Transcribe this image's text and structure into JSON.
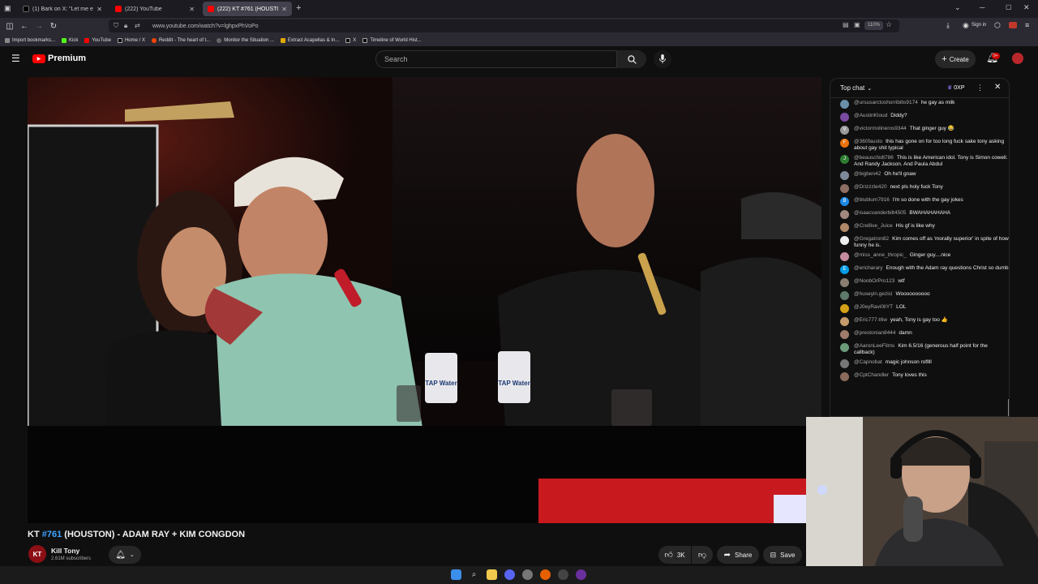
{
  "browser": {
    "tabs": [
      {
        "title": "(1) Bark on X: \"Let me explain w",
        "active": false
      },
      {
        "title": "(222) YouTube",
        "active": false
      },
      {
        "title": "(222) KT #761 (HOUSTON)",
        "active": true
      }
    ],
    "new_tab": "+",
    "url": "www.youtube.com/watch?v=lghpxPhVoPo",
    "zoom": "110%",
    "sign_in": "Sign in",
    "bookmarks": [
      "Import bookmarks...",
      "Kick",
      "YouTube",
      "Home / X",
      "Reddit - The heart of t...",
      "Monitor the Situation ...",
      "Extract Acapellas & In...",
      "X",
      "Timeline of World Hist..."
    ]
  },
  "youtube": {
    "logo_text": "Premium",
    "search_placeholder": "Search",
    "create_label": "Create",
    "notif_badge": "9+"
  },
  "chat": {
    "header": "Top chat",
    "points": "0XP",
    "messages": [
      {
        "author": "@ursusarctoshorribilis9174",
        "text": "he gay as milk",
        "color": "#6a8fa8"
      },
      {
        "author": "@AustinKloud",
        "text": "Diddy?",
        "color": "#7a4aa0"
      },
      {
        "author": "@victormolineros9344",
        "text": "That ginger guy 😂",
        "color": "#9a9a9a",
        "initial": "V"
      },
      {
        "author": "@360fausto",
        "text": "this has gone on for too long fuck sake tony asking about gay shit typical",
        "color": "#e8710a",
        "initial": "F"
      },
      {
        "author": "@beauschidt786",
        "text": "This is like American idol. Tony is Simon cowell. And Randy Jackson. And Paula Abdul",
        "color": "#2e7d32",
        "initial": "J"
      },
      {
        "author": "@bigben42",
        "text": "Oh he'll gnaw",
        "color": "#7c8a99"
      },
      {
        "author": "@Drizzzle420",
        "text": "next pls holy fuck Tony",
        "color": "#8d6e63"
      },
      {
        "author": "@blublum7916",
        "text": "I'm so done with the gay jokes",
        "color": "#1e88e5",
        "initial": "B"
      },
      {
        "author": "@isaacvanderbilt4505",
        "text": "BWAHAHAHAHA",
        "color": "#a1887f"
      },
      {
        "author": "@Cre8ive_Juice",
        "text": "His gf is like why",
        "color": "#b08968"
      },
      {
        "author": "@Gregatron82",
        "text": "Kim comes off as 'morally superior' in spite of how funny he is.",
        "color": "#eeeeee"
      },
      {
        "author": "@miss_anne_thropic_",
        "text": "Ginger guy....nice",
        "color": "#c48b9f"
      },
      {
        "author": "@ericharary",
        "text": "Enough with the Adam ray questions Christ so dumb",
        "color": "#039be5",
        "initial": "E"
      },
      {
        "author": "@NoobOrPro123",
        "text": "wtf",
        "color": "#8a7f70"
      },
      {
        "author": "@huseyin.gezici",
        "text": "Woooooooooo",
        "color": "#5d7a6a"
      },
      {
        "author": "@J0eyRavi0liYT",
        "text": "LOL",
        "color": "#d4a017"
      },
      {
        "author": "@Eric777-t6w",
        "text": "yeah, Tony is gay too 👍",
        "color": "#c49a6c"
      },
      {
        "author": "@prestonian8444",
        "text": "damn",
        "color": "#9e7b6a"
      },
      {
        "author": "@AaronLeeFilms",
        "text": "Kim 6.5/16 (generous half point for the callback)",
        "color": "#6a9a7a"
      },
      {
        "author": "@Capnobat",
        "text": "magic johnson rofllll",
        "color": "#777777"
      },
      {
        "author": "@CptChandler",
        "text": "Tony loves this",
        "color": "#8a6a5a"
      }
    ]
  },
  "video": {
    "title_prefix": "KT ",
    "title_episode": "#761",
    "title_rest": " (HOUSTON) - ADAM RAY + KIM CONGDON",
    "channel": "Kill Tony",
    "subscribers": "2.61M subscribers",
    "likes": "3K",
    "share_label": "Share",
    "save_label": "Save",
    "can_label": "TAP Water"
  }
}
